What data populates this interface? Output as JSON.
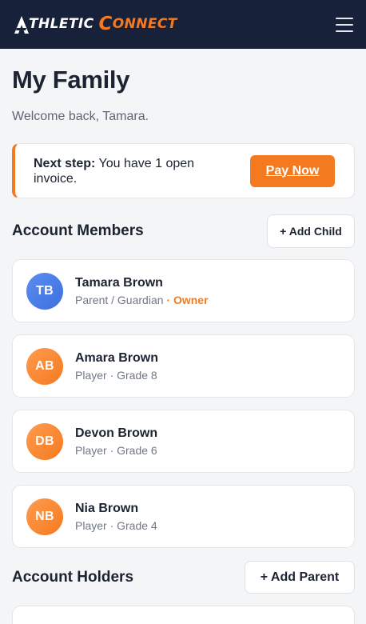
{
  "brand": {
    "name_athletic_first": "A",
    "name_athletic_rest": "THLETIC",
    "name_connect_first": "C",
    "name_connect_rest": "ONNECT",
    "accent_color": "#f47a20",
    "navbar_color": "#17213a"
  },
  "nav": {
    "menu_icon": "hamburger-menu-icon"
  },
  "page": {
    "title": "My Family",
    "welcome": "Welcome back, Tamara."
  },
  "notice": {
    "label": "Next step:",
    "message": " You have 1 open invoice.",
    "button": "Pay Now"
  },
  "members": {
    "title": "Account Members",
    "add_button": "+ Add Child",
    "items": [
      {
        "initials": "TB",
        "name": "Tamara Brown",
        "role": "Parent / Guardian",
        "badge": " · Owner",
        "avatar_color": "#4a7ee8"
      },
      {
        "initials": "AB",
        "name": "Amara Brown",
        "role": "Player · Grade 8",
        "badge": "",
        "avatar_color": "#f7863a"
      },
      {
        "initials": "DB",
        "name": "Devon Brown",
        "role": "Player · Grade 6",
        "badge": "",
        "avatar_color": "#f7863a"
      },
      {
        "initials": "NB",
        "name": "Nia Brown",
        "role": "Player · Grade 4",
        "badge": "",
        "avatar_color": "#f7863a"
      }
    ]
  },
  "holders": {
    "title": "Account Holders",
    "add_button": "+ Add Parent"
  }
}
